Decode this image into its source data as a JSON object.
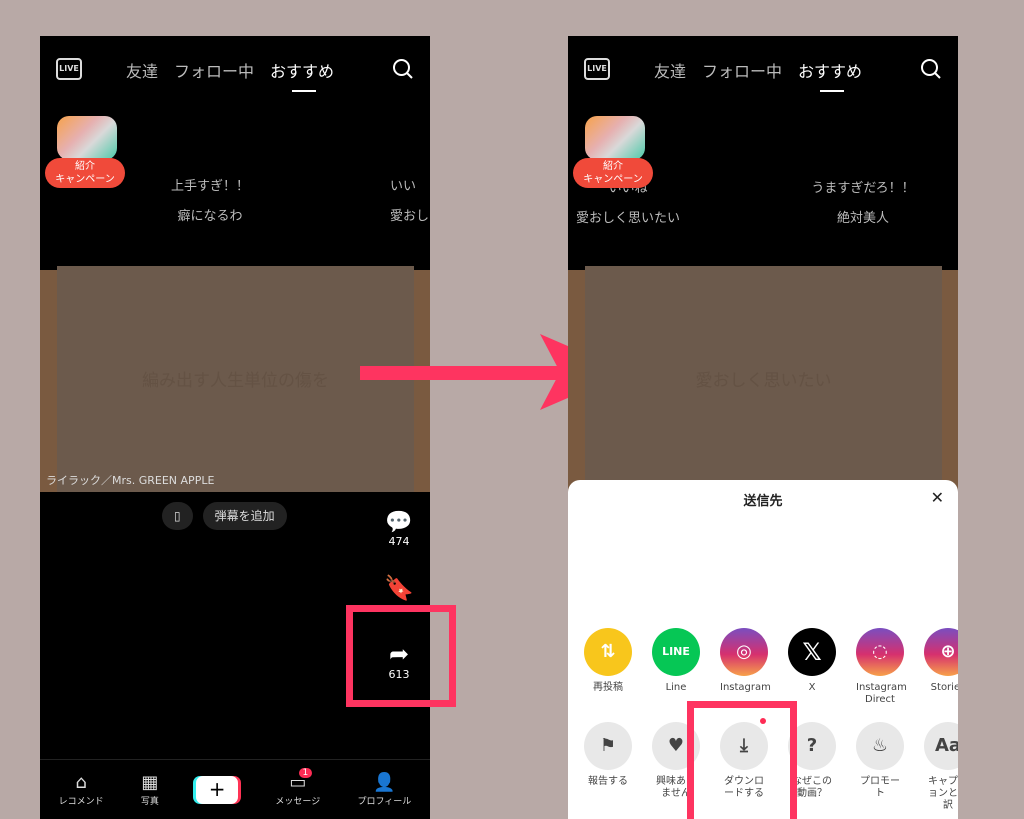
{
  "topbar": {
    "live": "LIVE",
    "tabs": [
      "友達",
      "フォロー中",
      "おすすめ"
    ],
    "active_tab": "おすすめ"
  },
  "badge": {
    "line1": "紹介",
    "line2": "キャンペーン"
  },
  "left": {
    "comments": [
      {
        "l1": "上手すぎ！！",
        "l2": "癖になるわ"
      },
      {
        "l1": "いい",
        "l2": "愛おし"
      }
    ],
    "video_text": "編み出す人生単位の傷を",
    "video_caption": "ライラック／Mrs. GREEN APPLE",
    "danmaku": "弾幕を追加",
    "comment_count": "474",
    "share_count": "613",
    "nav": [
      {
        "icon": "home-icon",
        "label": "レコメンド"
      },
      {
        "icon": "photo-icon",
        "label": "写真"
      },
      {
        "icon": "plus-icon",
        "label": ""
      },
      {
        "icon": "message-icon",
        "label": "メッセージ",
        "badge": "1"
      },
      {
        "icon": "profile-icon",
        "label": "プロフィール"
      }
    ]
  },
  "right": {
    "comments": [
      {
        "l1": "いいね",
        "l2": "愛おしく思いたい"
      },
      {
        "l1": "うますぎだろ！！",
        "l2": "絶対美人"
      }
    ],
    "video_text": "愛おしく思いたい",
    "sheet": {
      "title": "送信先",
      "row1": [
        {
          "label": "再投稿",
          "icon": "repost-icon",
          "color": "#f8c61c"
        },
        {
          "label": "Line",
          "icon": "line-icon",
          "color": "#06c755"
        },
        {
          "label": "Instagram",
          "icon": "instagram-icon",
          "color": "#d6306e"
        },
        {
          "label": "X",
          "icon": "x-icon",
          "color": "#000000"
        },
        {
          "label": "Instagram Direct",
          "icon": "messenger-icon",
          "color": "#c13584"
        },
        {
          "label": "Stories",
          "icon": "stories-icon",
          "color": "#d6306e"
        }
      ],
      "row2": [
        {
          "label": "報告する",
          "icon": "flag-icon"
        },
        {
          "label": "興味ありません",
          "icon": "broken-heart-icon"
        },
        {
          "label": "ダウンロードする",
          "icon": "download-icon"
        },
        {
          "label": "なぜこの動画？",
          "icon": "question-icon"
        },
        {
          "label": "プロモート",
          "icon": "flame-icon"
        },
        {
          "label": "キャプションと翻訳",
          "icon": "text-icon"
        }
      ]
    }
  },
  "colors": {
    "highlight": "#fe3460",
    "background": "#b8a9a6"
  }
}
